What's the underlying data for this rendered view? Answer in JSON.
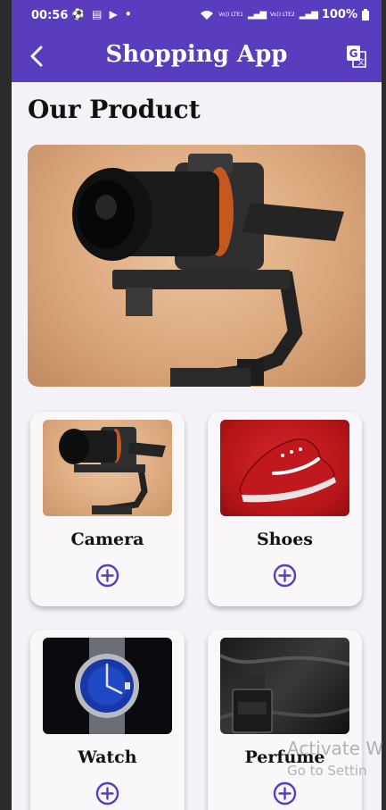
{
  "status_bar": {
    "time": "00:56",
    "left_icons": "⚽ ▤ ▶ •",
    "net1": "Vo)) LTE1",
    "net2": "Vo)) LTE2",
    "battery": "100%"
  },
  "app_bar": {
    "title": "Shopping App",
    "back_icon": "back-arrow-icon",
    "translate_icon": "translate-icon"
  },
  "page": {
    "heading": "Our Product"
  },
  "products": [
    {
      "label": "Camera",
      "image": "camera-on-gimbal"
    },
    {
      "label": "Shoes",
      "image": "red-sneaker"
    },
    {
      "label": "Watch",
      "image": "blue-dial-watch"
    },
    {
      "label": "Perfume",
      "image": "black-perfume-bottle"
    }
  ],
  "watermark": {
    "line1": "Activate W",
    "line2": "Go to Settin"
  },
  "colors": {
    "primary": "#5a3dbf",
    "background": "#f4f2f7",
    "add_icon": "#5a3dbf"
  }
}
